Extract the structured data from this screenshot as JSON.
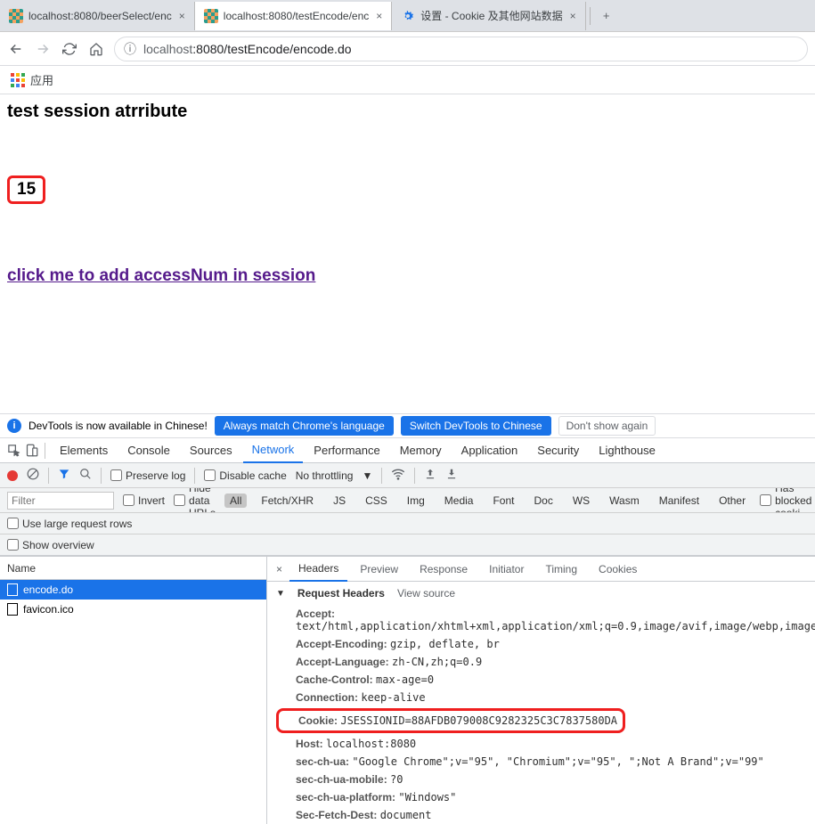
{
  "tabs": {
    "t1": "localhost:8080/beerSelect/enc",
    "t2": "localhost:8080/testEncode/enc",
    "t3": "设置 - Cookie 及其他网站数据"
  },
  "address": {
    "host": "localhost",
    "rest": ":8080/testEncode/encode.do"
  },
  "bookmark": {
    "apps": "应用"
  },
  "page": {
    "h2": "test session atrribute",
    "num": "15",
    "link": "click me to add accessNum in session"
  },
  "banner": {
    "msg": "DevTools is now available in Chinese!",
    "b1": "Always match Chrome's language",
    "b2": "Switch DevTools to Chinese",
    "b3": "Don't show again"
  },
  "dtabs": {
    "elements": "Elements",
    "console": "Console",
    "sources": "Sources",
    "network": "Network",
    "performance": "Performance",
    "memory": "Memory",
    "application": "Application",
    "security": "Security",
    "lighthouse": "Lighthouse"
  },
  "ntool": {
    "preserve": "Preserve log",
    "disable": "Disable cache",
    "throttle": "No throttling"
  },
  "nfilter": {
    "placeholder": "Filter",
    "invert": "Invert",
    "hide": "Hide data URLs",
    "all": "All",
    "types": [
      "Fetch/XHR",
      "JS",
      "CSS",
      "Img",
      "Media",
      "Font",
      "Doc",
      "WS",
      "Wasm",
      "Manifest",
      "Other"
    ],
    "blocked": "Has blocked cooki"
  },
  "nopts": {
    "large": "Use large request rows",
    "overview": "Show overview"
  },
  "reqlist": {
    "hdr": "Name",
    "r1": "encode.do",
    "r2": "favicon.ico"
  },
  "rtabs": {
    "headers": "Headers",
    "preview": "Preview",
    "response": "Response",
    "initiator": "Initiator",
    "timing": "Timing",
    "cookies": "Cookies"
  },
  "rh": {
    "title": "Request Headers",
    "vs": "View source",
    "accept_k": "Accept:",
    "accept_v": "text/html,application/xhtml+xml,application/xml;q=0.9,image/avif,image/webp,image/",
    "ae_k": "Accept-Encoding:",
    "ae_v": "gzip, deflate, br",
    "al_k": "Accept-Language:",
    "al_v": "zh-CN,zh;q=0.9",
    "cc_k": "Cache-Control:",
    "cc_v": "max-age=0",
    "conn_k": "Connection:",
    "conn_v": "keep-alive",
    "cookie_k": "Cookie:",
    "cookie_v": "JSESSIONID=88AFDB079008C9282325C3C7837580DA",
    "host_k": "Host:",
    "host_v": "localhost:8080",
    "scu_k": "sec-ch-ua:",
    "scu_v": "\"Google Chrome\";v=\"95\", \"Chromium\";v=\"95\", \";Not A Brand\";v=\"99\"",
    "scum_k": "sec-ch-ua-mobile:",
    "scum_v": "?0",
    "scup_k": "sec-ch-ua-platform:",
    "scup_v": "\"Windows\"",
    "sfd_k": "Sec-Fetch-Dest:",
    "sfd_v": "document"
  }
}
